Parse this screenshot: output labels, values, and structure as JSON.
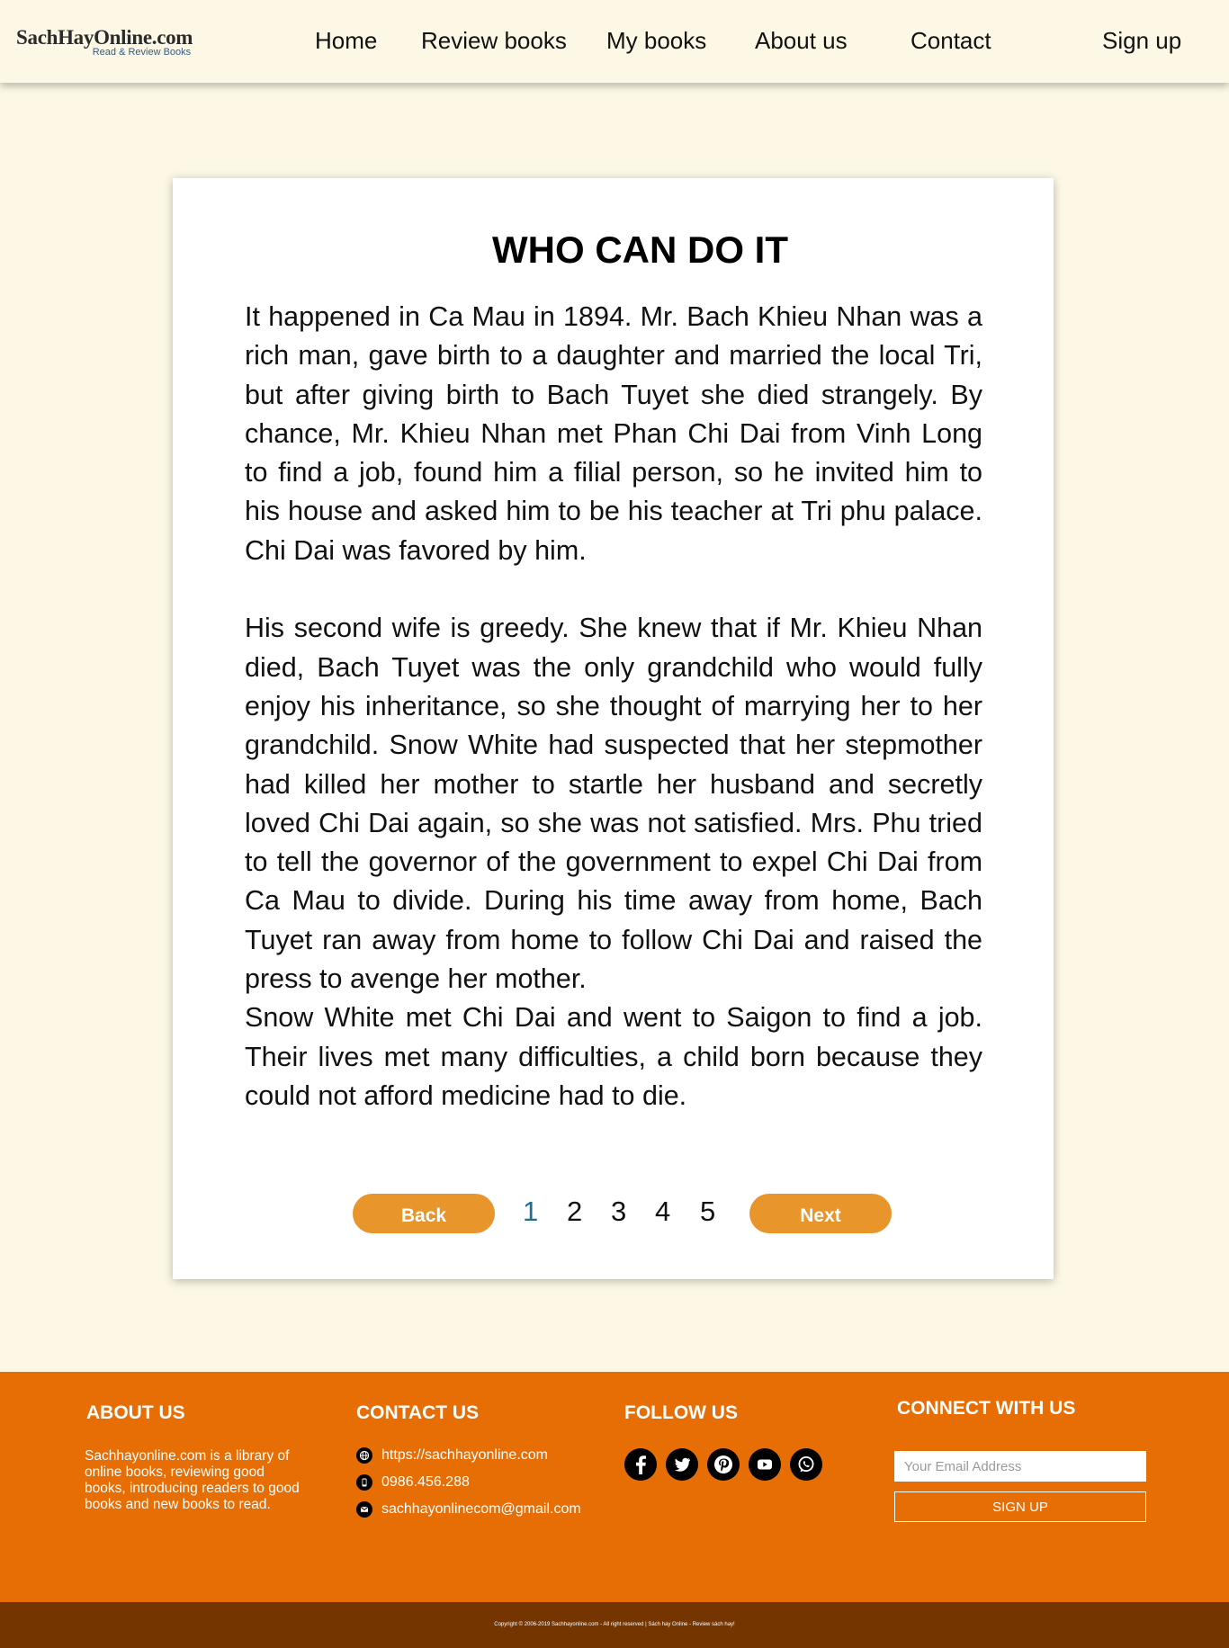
{
  "header": {
    "logo_title": "SachHayOnline.com",
    "logo_tagline": "Read & Review Books",
    "nav": {
      "home": "Home",
      "review_books": "Review books",
      "my_books": "My books",
      "about_us": "About us",
      "contact": "Contact",
      "sign_up": "Sign up"
    }
  },
  "story": {
    "title": "WHO CAN DO IT",
    "paragraphs": [
      "It happened in Ca Mau in 1894. Mr. Bach Khieu Nhan was a rich man, gave birth to a daughter and married the local Tri, but after giving birth to Bach Tuyet she died strangely. By chance, Mr. Khieu Nhan met Phan Chi Dai from Vinh Long to find a job, found him a filial person, so he invited him to his house and asked him to be his teacher at Tri phu palace. Chi Dai was favored by him.",
      "His second wife is greedy. She knew that if Mr. Khieu Nhan died, Bach Tuyet was the only grandchild who would fully enjoy his inheritance, so she thought of marrying her to her grandchild. Snow White had suspected that her stepmother had killed her mother to startle her husband and secretly loved Chi Dai again, so she was not satisfied. Mrs. Phu tried to tell the governor of the government to expel Chi Dai from Ca Mau to divide. During his time away from home, Bach Tuyet ran away from home to follow Chi Dai and raised the press to avenge her mother.",
      "Snow White met Chi Dai and went to Saigon to find a job. Their lives met many difficulties, a child born because they could not afford medicine had to die."
    ]
  },
  "pager": {
    "back_label": "Back",
    "next_label": "Next",
    "pages": [
      "1",
      "2",
      "3",
      "4",
      "5"
    ],
    "current_page": "1"
  },
  "footer": {
    "about": {
      "heading": "ABOUT US",
      "text": "Sachhayonline.com is a library of online books, reviewing good books, introducing readers to good books and new books to read."
    },
    "contact": {
      "heading": "CONTACT US",
      "website": "https://sachhayonline.com",
      "phone": "0986.456.288",
      "email": "sachhayonlinecom@gmail.com"
    },
    "follow": {
      "heading": "FOLLOW US",
      "icons": [
        "facebook-icon",
        "twitter-icon",
        "pinterest-icon",
        "youtube-icon",
        "whatsapp-icon"
      ]
    },
    "connect": {
      "heading": "CONNECT WITH US",
      "email_placeholder": "Your Email Address",
      "signup_label": "SIGN UP"
    },
    "copyright": "Copyright © 2006-2019 Sachhayonline.com - All right reserved | Sách hay Online - Review sách hay!"
  },
  "colors": {
    "page_bg": "#fdf8e6",
    "accent_orange": "#e8952c",
    "footer_orange": "#e66e05",
    "footer_bottom": "#743501",
    "active_page": "#1e6e8e"
  }
}
